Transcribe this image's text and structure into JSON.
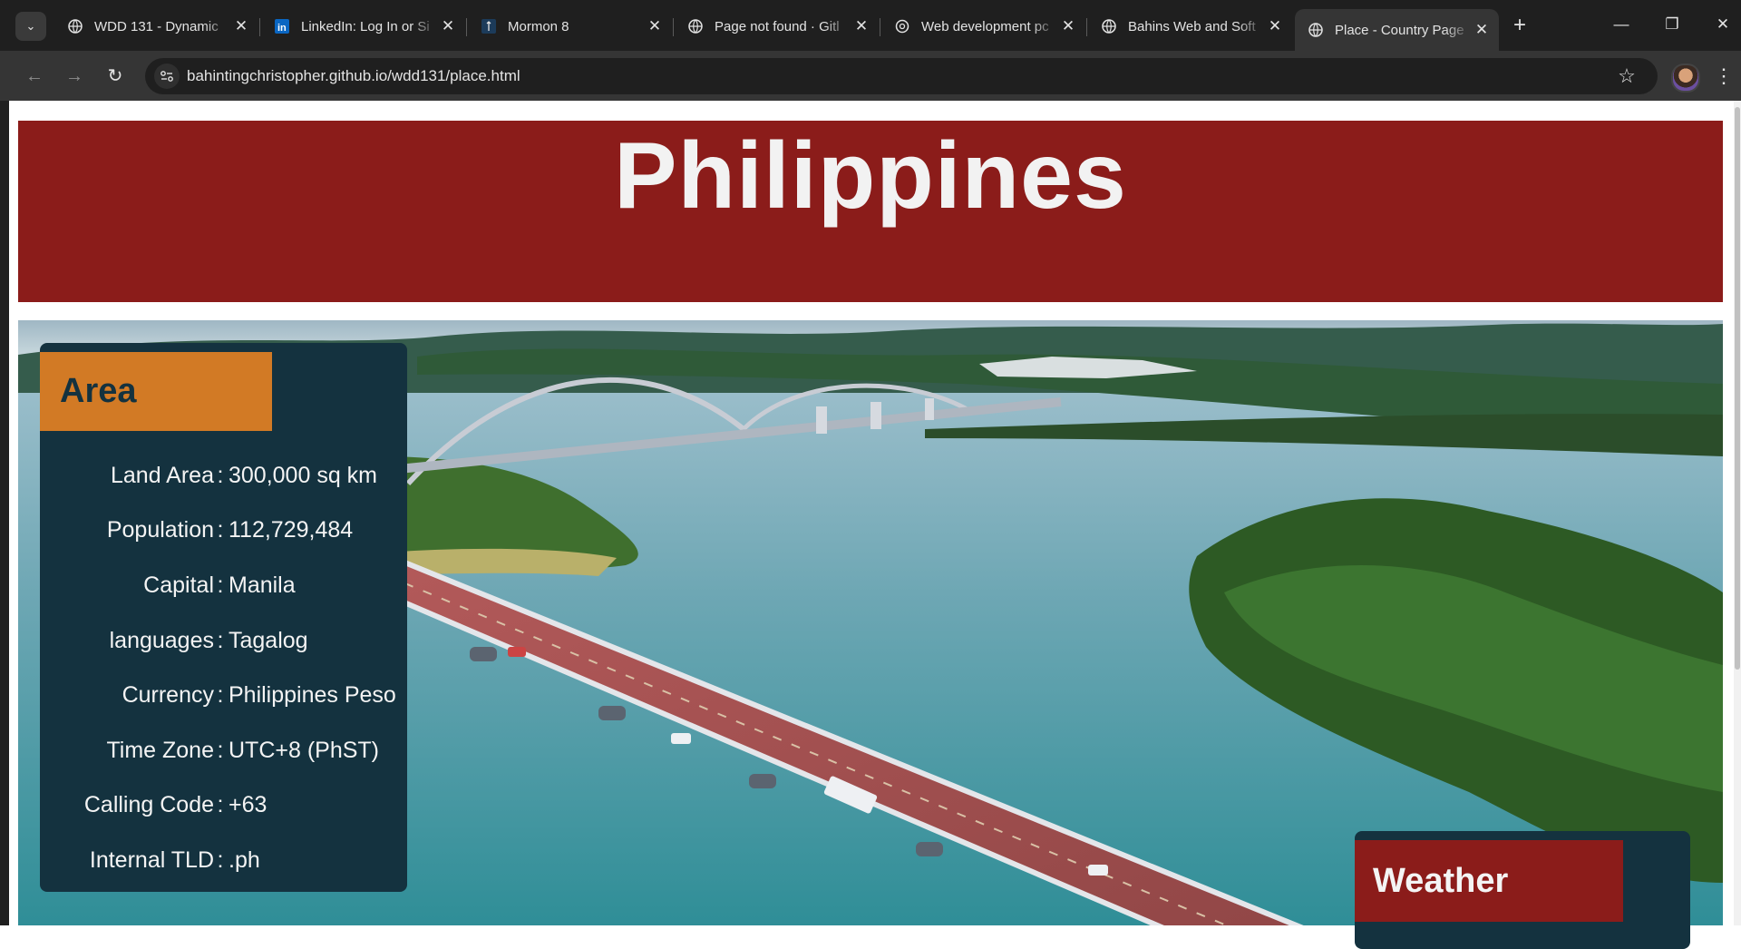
{
  "browser": {
    "tabs": [
      {
        "title": "WDD 131 - Dynamic",
        "icon": "globe-icon",
        "active": false
      },
      {
        "title": "LinkedIn: Log In or Si",
        "icon": "linkedin-icon",
        "active": false
      },
      {
        "title": "Mormon 8",
        "icon": "book-icon",
        "active": false
      },
      {
        "title": "Page not found · Gitl",
        "icon": "globe-icon",
        "active": false
      },
      {
        "title": "Web development pc",
        "icon": "chatgpt-icon",
        "active": false
      },
      {
        "title": "Bahins Web and Soft",
        "icon": "globe-icon",
        "active": false
      },
      {
        "title": "Place - Country Page",
        "icon": "globe-icon",
        "active": true
      }
    ],
    "address": "bahintingchristopher.github.io/wdd131/place.html"
  },
  "page": {
    "title": "Philippines",
    "area": {
      "heading": "Area",
      "facts": [
        {
          "label": "Land Area",
          "value": "300,000 sq km"
        },
        {
          "label": "Population",
          "value": "112,729,484"
        },
        {
          "label": "Capital",
          "value": "Manila"
        },
        {
          "label": "languages",
          "value": "Tagalog"
        },
        {
          "label": "Currency",
          "value": "Philippines Peso"
        },
        {
          "label": "Time Zone",
          "value": "UTC+8 (PhST)"
        },
        {
          "label": "Calling Code",
          "value": "+63"
        },
        {
          "label": "Internal TLD",
          "value": ".ph"
        }
      ]
    },
    "weather": {
      "heading": "Weather"
    }
  },
  "colors": {
    "header_bg": "#8b1c1a",
    "card_bg": "#14323f",
    "area_accent": "#d27a25"
  }
}
